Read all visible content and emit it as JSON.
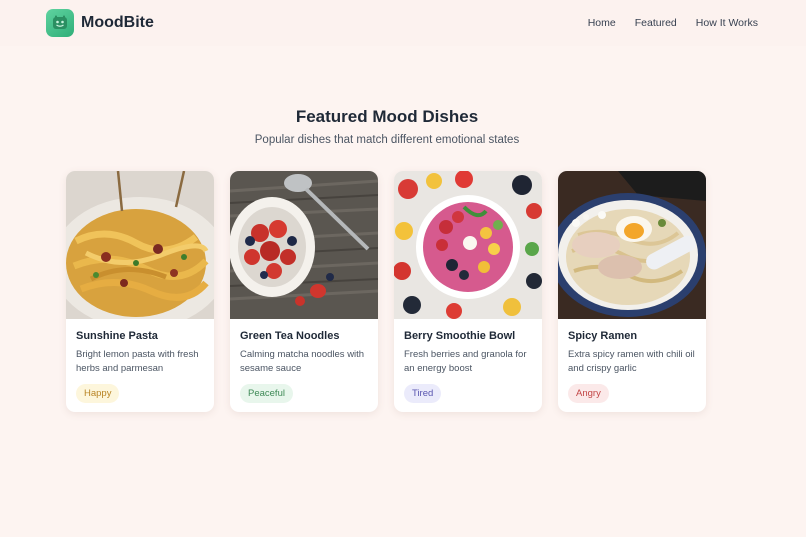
{
  "header": {
    "logo_icon": "smiling-face-icon",
    "app_name": "MoodBite",
    "nav": [
      "Home",
      "Featured",
      "How It Works"
    ]
  },
  "section": {
    "title": "Featured Mood Dishes",
    "subtitle": "Popular dishes that match different emotional states"
  },
  "dishes": [
    {
      "title": "Sunshine Pasta",
      "description": "Bright lemon pasta with fresh herbs and parmesan",
      "mood": "Happy",
      "mood_color": "#b98526",
      "mood_bg": "#fdf6dc"
    },
    {
      "title": "Green Tea Noodles",
      "description": "Calming matcha noodles with sesame sauce",
      "mood": "Peaceful",
      "mood_color": "#3f8a57",
      "mood_bg": "#e8f6ec"
    },
    {
      "title": "Berry Smoothie Bowl",
      "description": "Fresh berries and granola for an energy boost",
      "mood": "Tired",
      "mood_color": "#5a56b0",
      "mood_bg": "#ebebfb"
    },
    {
      "title": "Spicy Ramen",
      "description": "Extra spicy ramen with chili oil and crispy garlic",
      "mood": "Angry",
      "mood_color": "#c24545",
      "mood_bg": "#fbe9e9"
    }
  ],
  "colors": {
    "background": "#fdf4f1",
    "brand": "#3dbd86"
  }
}
